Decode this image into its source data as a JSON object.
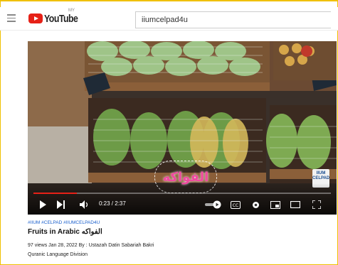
{
  "header": {
    "logo_text": "YouTube",
    "logo_region": "MY",
    "search_value": "iiumcelpad4u"
  },
  "player": {
    "overlay_text": "الفواكه",
    "watermark_text": "IIUM CELPAD",
    "time_display": "0:23 / 2:37",
    "progress": 0.146
  },
  "video_info": {
    "hashtags": "#IIUM #CELPAD #IIUMCELPAD4U",
    "title": "Fruits in Arabic الفواكه",
    "meta": "97 views  Jan 28, 2022  By : Ustazah Datin Sabariah Bakri",
    "channel": "Quranic Language Division"
  },
  "colors": {
    "frame": "#f0c000",
    "brand_red": "#e62117",
    "hashtag": "#1a5fcc"
  }
}
